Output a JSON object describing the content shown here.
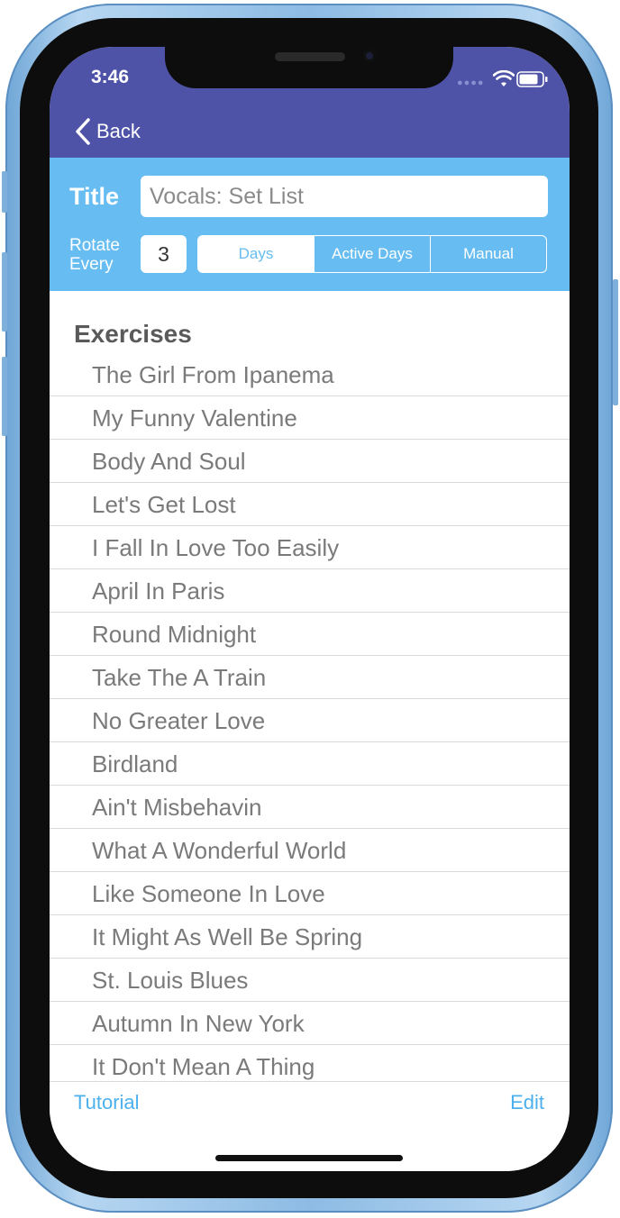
{
  "status_bar": {
    "time": "3:46",
    "signal_icon": "signal-dots-icon",
    "wifi_icon": "wifi-icon",
    "battery_icon": "battery-icon"
  },
  "nav": {
    "back_label": "Back",
    "back_icon": "chevron-left-icon"
  },
  "settings": {
    "title_label": "Title",
    "title_value": "Vocals: Set List",
    "rotate_label": "Rotate Every",
    "rotate_value": "3",
    "segments": [
      "Days",
      "Active Days",
      "Manual"
    ],
    "selected_segment": "Days"
  },
  "exercises": {
    "heading": "Exercises",
    "items": [
      "The Girl From Ipanema",
      "My Funny Valentine",
      "Body And Soul",
      "Let's Get Lost",
      "I Fall In Love Too Easily",
      "April In Paris",
      "Round Midnight",
      "Take The A Train",
      "No Greater Love",
      "Birdland",
      "Ain't Misbehavin",
      "What A Wonderful World",
      "Like Someone In Love",
      "It Might As Well Be Spring",
      "St. Louis Blues",
      "Autumn In New York",
      "It Don't Mean A Thing"
    ]
  },
  "toolbar": {
    "tutorial_label": "Tutorial",
    "edit_label": "Edit"
  },
  "colors": {
    "nav_bg": "#4f53a8",
    "panel_bg": "#67bdf2",
    "accent": "#4cb0ee",
    "phone_frame": "#8dbbe4"
  }
}
